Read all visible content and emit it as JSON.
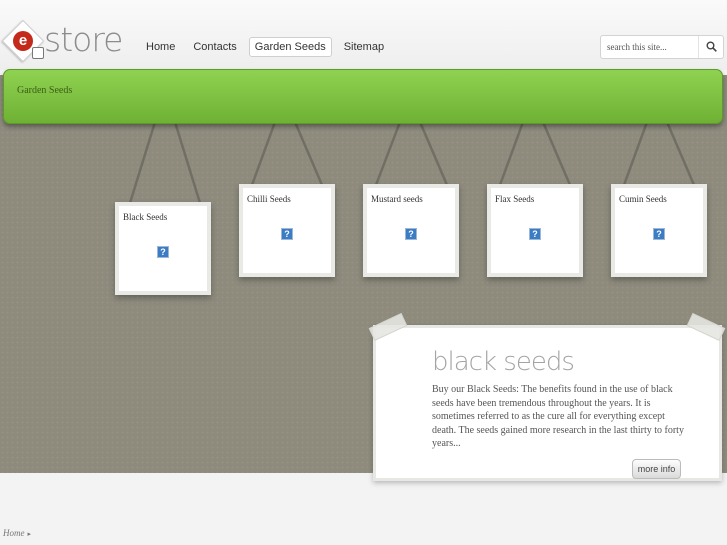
{
  "logo": {
    "letter": "e",
    "text": "store"
  },
  "nav": [
    {
      "label": "Home",
      "active": false
    },
    {
      "label": "Contacts",
      "active": false
    },
    {
      "label": "Garden Seeds",
      "active": true
    },
    {
      "label": "Sitemap",
      "active": false
    }
  ],
  "search": {
    "placeholder": "search this site...",
    "icon": "search-icon"
  },
  "banner": {
    "breadcrumb": "Garden Seeds"
  },
  "products": [
    {
      "title": "Black Seeds",
      "icon": "image-placeholder-icon",
      "icon_glyph": "?"
    },
    {
      "title": "Chilli Seeds",
      "icon": "image-placeholder-icon",
      "icon_glyph": "?"
    },
    {
      "title": "Mustard seeds",
      "icon": "image-placeholder-icon",
      "icon_glyph": "?"
    },
    {
      "title": "Flax Seeds",
      "icon": "image-placeholder-icon",
      "icon_glyph": "?"
    },
    {
      "title": "Cumin Seeds",
      "icon": "image-placeholder-icon",
      "icon_glyph": "?"
    }
  ],
  "feature": {
    "title": "black seeds",
    "text": "Buy our Black Seeds: The benefits found in the use of black seeds have been tremendous throughout the years. It is sometimes referred to as the cure all for everything except death. The seeds gained more research in the last thirty to forty years...",
    "button": "more info"
  },
  "footer": {
    "breadcrumb": "Home",
    "separator": "▸"
  },
  "colors": {
    "accent_green": "#7fc143",
    "wall": "#8e8b7d",
    "logo_red": "#c42a1c"
  }
}
